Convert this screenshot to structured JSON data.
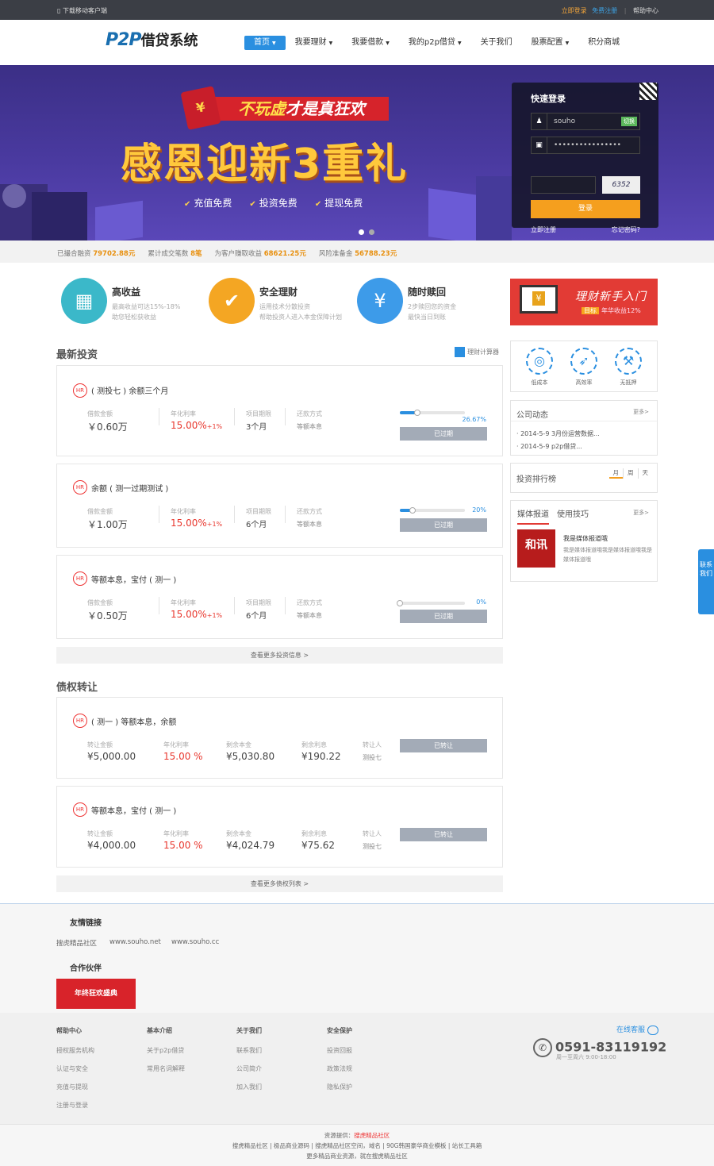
{
  "topbar": {
    "download": "下载移动客户端",
    "login": "立即登录",
    "register": "免费注册",
    "help": "帮助中心"
  },
  "header": {
    "logo_en": "P2P",
    "logo_cn": "借贷系统",
    "nav": [
      "首页",
      "我要理财",
      "我要借款",
      "我的p2p借贷",
      "关于我们",
      "股票配置",
      "积分商城"
    ]
  },
  "banner": {
    "ribbon_a": "不玩虚",
    "ribbon_b": "才是真狂欢",
    "redpack": "¥",
    "headline": "感恩迎新3重礼",
    "perks": [
      "充值免费",
      "投资免费",
      "提现免费"
    ]
  },
  "quick_login": {
    "title": "快速登录",
    "username": "souho",
    "switch": "切换",
    "password": "••••••••••••••••",
    "captcha_code": "6352",
    "login_btn": "登录",
    "register_link": "立即注册",
    "forgot_link": "忘记密码?"
  },
  "stats": [
    {
      "label": "已撮合融资",
      "value": "79702.88元"
    },
    {
      "label": "累计成交笔数",
      "value": "8笔"
    },
    {
      "label": "为客户赚取收益",
      "value": "68621.25元"
    },
    {
      "label": "风险准备金",
      "value": "56788.23元"
    }
  ],
  "features": [
    {
      "title": "高收益",
      "desc1": "最高收益可达15%-18%",
      "desc2": "助您轻松获收益",
      "color": "#3bb8c9"
    },
    {
      "title": "安全理财",
      "desc1": "运用技术分散投资",
      "desc2": "帮助投资人进入本金保障计划",
      "color": "#f4a623"
    },
    {
      "title": "随时赎回",
      "desc1": "2步赎回您的资金",
      "desc2": "最快当日到账",
      "color": "#3d9be9"
    }
  ],
  "promo": {
    "title": "理财新手入门",
    "tag": "目标",
    "sub": "年华收益12%"
  },
  "invest": {
    "title": "最新投资",
    "calc": "理财计算器",
    "labels": {
      "amount": "借款金额",
      "rate": "年化利率",
      "term": "项目期限",
      "repay": "还款方式"
    },
    "items": [
      {
        "name": "( 测投七 ) 余额三个月",
        "amount": "￥0.60万",
        "rate": "15.00%",
        "bonus": "+1%",
        "term": "3个月",
        "repay": "等额本息",
        "progress": 26.67,
        "pct": "26.67%",
        "status": "已过期"
      },
      {
        "name": "余额 ( 测一过期测试 )",
        "amount": "￥1.00万",
        "rate": "15.00%",
        "bonus": "+1%",
        "term": "6个月",
        "repay": "等额本息",
        "progress": 20,
        "pct": "20%",
        "status": "已过期"
      },
      {
        "name": "等额本息，宝付 ( 测一 )",
        "amount": "￥0.50万",
        "rate": "15.00%",
        "bonus": "+1%",
        "term": "6个月",
        "repay": "等额本息",
        "progress": 0,
        "pct": "0%",
        "status": "已过期"
      }
    ],
    "more": "查看更多投资信息 >"
  },
  "transfer": {
    "title": "债权转让",
    "labels": {
      "amount": "转让金额",
      "rate": "年化利率",
      "principal": "剩余本金",
      "interest": "剩余利息",
      "person": "转让人"
    },
    "items": [
      {
        "name": "( 测一 ) 等额本息，余额",
        "amount": "¥5,000.00",
        "rate": "15.00 %",
        "principal": "¥5,030.80",
        "interest": "¥190.22",
        "person": "测投七",
        "status": "已转让"
      },
      {
        "name": "等额本息，宝付 ( 测一 )",
        "amount": "¥4,000.00",
        "rate": "15.00 %",
        "principal": "¥4,024.79",
        "interest": "¥75.62",
        "person": "测投七",
        "status": "已转让"
      }
    ],
    "more": "查看更多债权列表 >"
  },
  "sidebar": {
    "icons": [
      {
        "label": "低成本",
        "glyph": "◎"
      },
      {
        "label": "高效率",
        "glyph": "➶"
      },
      {
        "label": "无抵押",
        "glyph": "⚒"
      }
    ],
    "news_title": "公司动态",
    "news_more": "更多>",
    "news": [
      "2014-5-9 3月份运营数据...",
      "2014-5-9 p2p借贷..."
    ],
    "rank_title": "投资排行榜",
    "rank_tabs": [
      "月",
      "周",
      "天"
    ],
    "media_tabs": [
      "媒体报道",
      "使用技巧"
    ],
    "media_more": "更多>",
    "media_logo": "和讯",
    "media_title": "我是媒体报道哦",
    "media_desc": "我是媒体报道哦我是媒体报道哦我是媒体报道哦"
  },
  "float_contact": "联系我们",
  "friends": {
    "title": "友情链接",
    "links": [
      "搜虎精品社区",
      "www.souho.net",
      "www.souho.cc"
    ],
    "partner_title": "合作伙伴",
    "partner_banner": "年终狂欢盛典"
  },
  "footer": {
    "cols": [
      {
        "title": "帮助中心",
        "items": [
          "授权服务机构",
          "认证与安全",
          "充值与提现",
          "注册与登录"
        ]
      },
      {
        "title": "基本介绍",
        "items": [
          "关于p2p借贷",
          "常用名词解释"
        ]
      },
      {
        "title": "关于我们",
        "items": [
          "联系我们",
          "公司简介",
          "加入我们"
        ]
      },
      {
        "title": "安全保护",
        "items": [
          "投资回报",
          "政策法规",
          "隐私保护"
        ]
      }
    ],
    "service": "在线客服",
    "phone": "0591-83119192",
    "phone_time": "周一至周六 9:00-18:00"
  },
  "bottom": {
    "source_label": "资源提供：",
    "source_name": "搜虎精品社区",
    "line2": "搜虎精品社区 | 极品商业源码 | 搜虎精品社区空间，域名 | 90G韩国豪华商业模板 | 站长工具箱",
    "line3": "更多精品商业资源，就在搜虎精品社区"
  }
}
